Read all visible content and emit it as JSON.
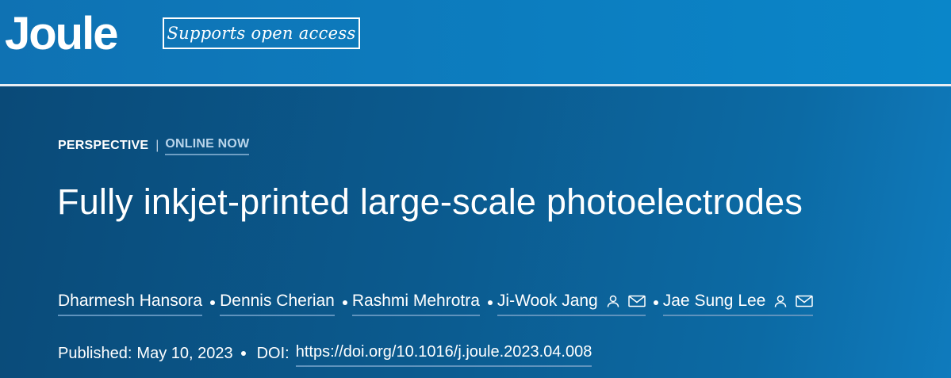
{
  "header": {
    "logo": "Joule",
    "open_access_label": "Supports open access"
  },
  "article": {
    "type": "PERSPECTIVE",
    "separator": "|",
    "status": "ONLINE NOW",
    "title": "Fully inkjet-printed large-scale photoelectrodes",
    "authors": [
      {
        "name": "Dharmesh Hansora",
        "icons": []
      },
      {
        "name": "Dennis Cherian",
        "icons": []
      },
      {
        "name": "Rashmi Mehrotra",
        "icons": []
      },
      {
        "name": "Ji-Wook Jang",
        "icons": [
          "person-icon",
          "email-icon"
        ]
      },
      {
        "name": "Jae Sung Lee",
        "icons": [
          "person-icon",
          "email-icon"
        ]
      }
    ],
    "published_label": "Published:",
    "published_date": "May 10, 2023",
    "doi_label": "DOI:",
    "doi_url": "https://doi.org/10.1016/j.joule.2023.04.008"
  },
  "colors": {
    "header_blue": "#0a86c9",
    "hero_dark": "#0a4a78",
    "link_underline": "#5f93bd"
  }
}
